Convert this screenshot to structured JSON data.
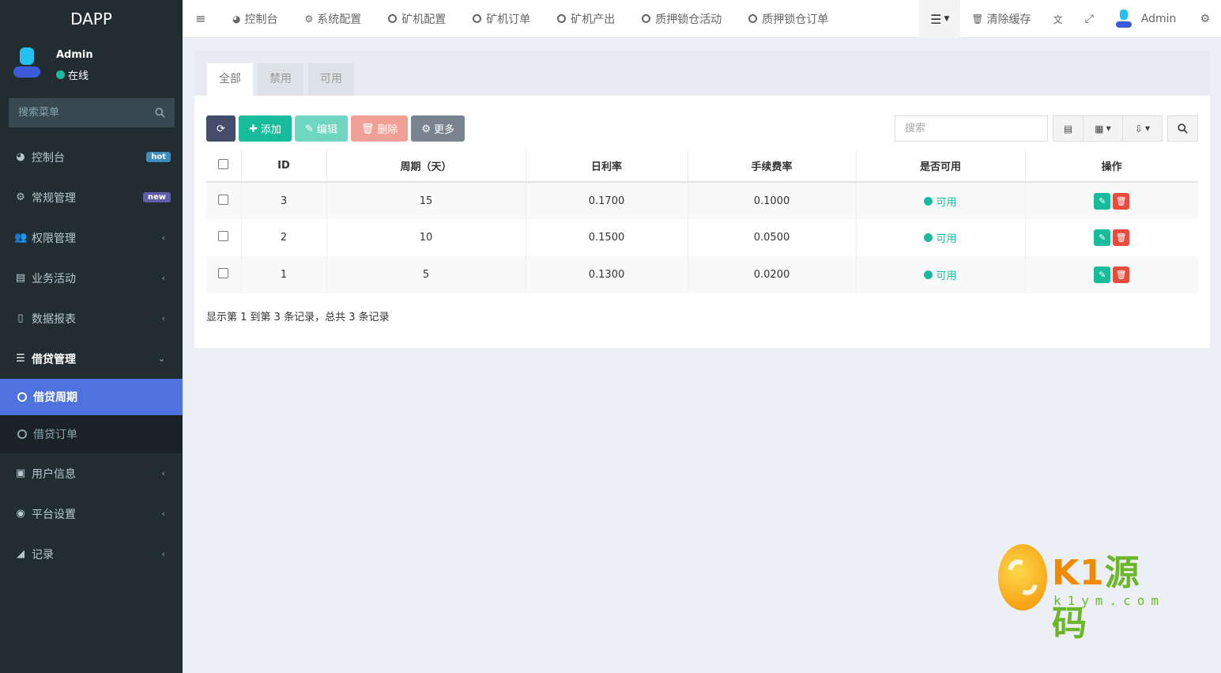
{
  "app": {
    "title": "DAPP"
  },
  "user": {
    "name": "Admin",
    "status": "在线"
  },
  "sidebar": {
    "search_placeholder": "搜索菜单",
    "items": [
      {
        "label": "控制台",
        "icon": "dashboard-icon",
        "badge": "hot"
      },
      {
        "label": "常规管理",
        "icon": "cogs-icon",
        "badge": "new"
      },
      {
        "label": "权限管理",
        "icon": "group-icon"
      },
      {
        "label": "业务活动",
        "icon": "list-alt-icon"
      },
      {
        "label": "数据报表",
        "icon": "file-text-icon"
      },
      {
        "label": "借贷管理",
        "icon": "list-icon",
        "open": true
      },
      {
        "label": "用户信息",
        "icon": "address-book-icon"
      },
      {
        "label": "平台设置",
        "icon": "dot-circle-icon"
      },
      {
        "label": "记录",
        "icon": "area-chart-icon"
      }
    ],
    "submenu": [
      {
        "label": "借贷周期",
        "active": true
      },
      {
        "label": "借贷订单"
      }
    ]
  },
  "header": {
    "tabs": [
      {
        "label": "控制台",
        "icon": "dashboard-icon"
      },
      {
        "label": "系统配置",
        "icon": "cog-icon"
      },
      {
        "label": "矿机配置"
      },
      {
        "label": "矿机订单"
      },
      {
        "label": "矿机产出"
      },
      {
        "label": "质押锁仓活动"
      },
      {
        "label": "质押锁仓订单"
      }
    ],
    "clear_cache": "清除缓存",
    "admin_label": "Admin"
  },
  "panel": {
    "tabs": [
      "全部",
      "禁用",
      "可用"
    ],
    "toolbar": {
      "add": "添加",
      "edit": "编辑",
      "delete": "删除",
      "more": "更多"
    },
    "search_placeholder": "搜索"
  },
  "table": {
    "columns": [
      "ID",
      "周期（天）",
      "日利率",
      "手续费率",
      "是否可用",
      "操作"
    ],
    "rows": [
      {
        "id": "3",
        "period": "15",
        "daily_rate": "0.1700",
        "fee_rate": "0.1000",
        "status": "可用"
      },
      {
        "id": "2",
        "period": "10",
        "daily_rate": "0.1500",
        "fee_rate": "0.0500",
        "status": "可用"
      },
      {
        "id": "1",
        "period": "5",
        "daily_rate": "0.1300",
        "fee_rate": "0.0200",
        "status": "可用"
      }
    ],
    "pagination_info": "显示第 1 到第 3 条记录，总共 3 条记录"
  },
  "watermark": {
    "title_a": "K1",
    "title_b": "源码",
    "url": "k1ym.com"
  },
  "colors": {
    "sidebar_bg": "#222d32",
    "active": "#4e73df",
    "success": "#18bc9c",
    "danger": "#e74c3c"
  }
}
